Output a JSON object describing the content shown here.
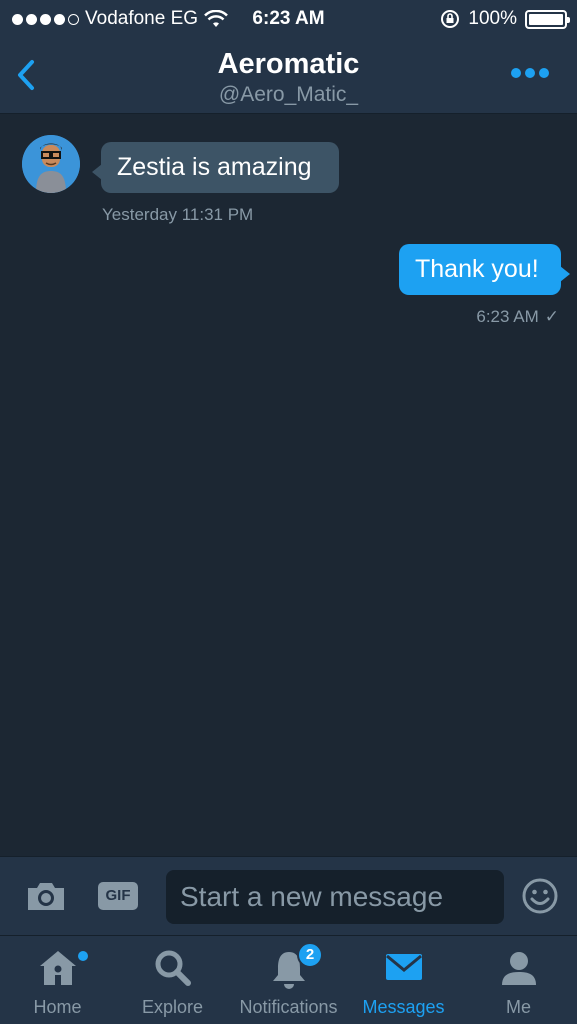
{
  "status_bar": {
    "carrier": "Vodafone EG",
    "time": "6:23 AM",
    "battery": "100%",
    "battery_level": 1.0
  },
  "header": {
    "title": "Aeromatic",
    "handle": "@Aero_Matic_",
    "back_icon": "chevron-left-icon",
    "more_icon": "more-dots-icon"
  },
  "messages": [
    {
      "direction": "incoming",
      "text": "Zestia is amazing",
      "time": "Yesterday 11:31 PM"
    },
    {
      "direction": "outgoing",
      "text": "Thank you!",
      "time": "6:23 AM",
      "status": "✓"
    }
  ],
  "composer": {
    "placeholder": "Start a new message",
    "gif_label": "GIF",
    "camera_icon": "camera-icon",
    "emoji_icon": "emoji-icon"
  },
  "tabs": [
    {
      "label": "Home",
      "icon": "home-icon"
    },
    {
      "label": "Explore",
      "icon": "search-icon"
    },
    {
      "label": "Notifications",
      "icon": "bell-icon",
      "badge": "2"
    },
    {
      "label": "Messages",
      "icon": "envelope-icon",
      "active": true
    },
    {
      "label": "Me",
      "icon": "person-icon"
    }
  ],
  "colors": {
    "accent": "#1da1f2",
    "background": "#1c2733",
    "bar": "#243447",
    "muted": "#8899a6",
    "incoming_bubble": "#3d5466"
  }
}
